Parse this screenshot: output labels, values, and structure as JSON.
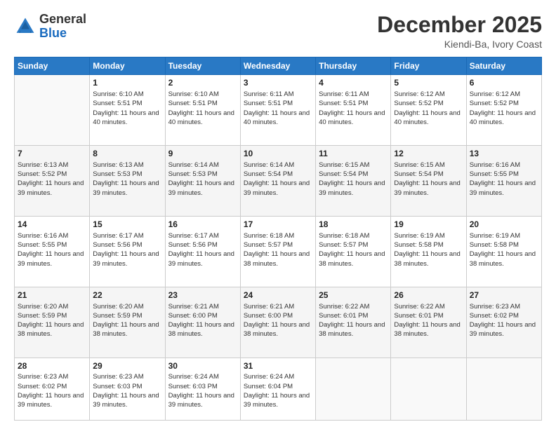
{
  "header": {
    "logo_general": "General",
    "logo_blue": "Blue",
    "month_title": "December 2025",
    "location": "Kiendi-Ba, Ivory Coast"
  },
  "days_of_week": [
    "Sunday",
    "Monday",
    "Tuesday",
    "Wednesday",
    "Thursday",
    "Friday",
    "Saturday"
  ],
  "weeks": [
    [
      {
        "day": "",
        "sunrise": "",
        "sunset": "",
        "daylight": "",
        "empty": true
      },
      {
        "day": "1",
        "sunrise": "Sunrise: 6:10 AM",
        "sunset": "Sunset: 5:51 PM",
        "daylight": "Daylight: 11 hours and 40 minutes."
      },
      {
        "day": "2",
        "sunrise": "Sunrise: 6:10 AM",
        "sunset": "Sunset: 5:51 PM",
        "daylight": "Daylight: 11 hours and 40 minutes."
      },
      {
        "day": "3",
        "sunrise": "Sunrise: 6:11 AM",
        "sunset": "Sunset: 5:51 PM",
        "daylight": "Daylight: 11 hours and 40 minutes."
      },
      {
        "day": "4",
        "sunrise": "Sunrise: 6:11 AM",
        "sunset": "Sunset: 5:51 PM",
        "daylight": "Daylight: 11 hours and 40 minutes."
      },
      {
        "day": "5",
        "sunrise": "Sunrise: 6:12 AM",
        "sunset": "Sunset: 5:52 PM",
        "daylight": "Daylight: 11 hours and 40 minutes."
      },
      {
        "day": "6",
        "sunrise": "Sunrise: 6:12 AM",
        "sunset": "Sunset: 5:52 PM",
        "daylight": "Daylight: 11 hours and 40 minutes."
      }
    ],
    [
      {
        "day": "7",
        "sunrise": "Sunrise: 6:13 AM",
        "sunset": "Sunset: 5:52 PM",
        "daylight": "Daylight: 11 hours and 39 minutes."
      },
      {
        "day": "8",
        "sunrise": "Sunrise: 6:13 AM",
        "sunset": "Sunset: 5:53 PM",
        "daylight": "Daylight: 11 hours and 39 minutes."
      },
      {
        "day": "9",
        "sunrise": "Sunrise: 6:14 AM",
        "sunset": "Sunset: 5:53 PM",
        "daylight": "Daylight: 11 hours and 39 minutes."
      },
      {
        "day": "10",
        "sunrise": "Sunrise: 6:14 AM",
        "sunset": "Sunset: 5:54 PM",
        "daylight": "Daylight: 11 hours and 39 minutes."
      },
      {
        "day": "11",
        "sunrise": "Sunrise: 6:15 AM",
        "sunset": "Sunset: 5:54 PM",
        "daylight": "Daylight: 11 hours and 39 minutes."
      },
      {
        "day": "12",
        "sunrise": "Sunrise: 6:15 AM",
        "sunset": "Sunset: 5:54 PM",
        "daylight": "Daylight: 11 hours and 39 minutes."
      },
      {
        "day": "13",
        "sunrise": "Sunrise: 6:16 AM",
        "sunset": "Sunset: 5:55 PM",
        "daylight": "Daylight: 11 hours and 39 minutes."
      }
    ],
    [
      {
        "day": "14",
        "sunrise": "Sunrise: 6:16 AM",
        "sunset": "Sunset: 5:55 PM",
        "daylight": "Daylight: 11 hours and 39 minutes."
      },
      {
        "day": "15",
        "sunrise": "Sunrise: 6:17 AM",
        "sunset": "Sunset: 5:56 PM",
        "daylight": "Daylight: 11 hours and 39 minutes."
      },
      {
        "day": "16",
        "sunrise": "Sunrise: 6:17 AM",
        "sunset": "Sunset: 5:56 PM",
        "daylight": "Daylight: 11 hours and 39 minutes."
      },
      {
        "day": "17",
        "sunrise": "Sunrise: 6:18 AM",
        "sunset": "Sunset: 5:57 PM",
        "daylight": "Daylight: 11 hours and 38 minutes."
      },
      {
        "day": "18",
        "sunrise": "Sunrise: 6:18 AM",
        "sunset": "Sunset: 5:57 PM",
        "daylight": "Daylight: 11 hours and 38 minutes."
      },
      {
        "day": "19",
        "sunrise": "Sunrise: 6:19 AM",
        "sunset": "Sunset: 5:58 PM",
        "daylight": "Daylight: 11 hours and 38 minutes."
      },
      {
        "day": "20",
        "sunrise": "Sunrise: 6:19 AM",
        "sunset": "Sunset: 5:58 PM",
        "daylight": "Daylight: 11 hours and 38 minutes."
      }
    ],
    [
      {
        "day": "21",
        "sunrise": "Sunrise: 6:20 AM",
        "sunset": "Sunset: 5:59 PM",
        "daylight": "Daylight: 11 hours and 38 minutes."
      },
      {
        "day": "22",
        "sunrise": "Sunrise: 6:20 AM",
        "sunset": "Sunset: 5:59 PM",
        "daylight": "Daylight: 11 hours and 38 minutes."
      },
      {
        "day": "23",
        "sunrise": "Sunrise: 6:21 AM",
        "sunset": "Sunset: 6:00 PM",
        "daylight": "Daylight: 11 hours and 38 minutes."
      },
      {
        "day": "24",
        "sunrise": "Sunrise: 6:21 AM",
        "sunset": "Sunset: 6:00 PM",
        "daylight": "Daylight: 11 hours and 38 minutes."
      },
      {
        "day": "25",
        "sunrise": "Sunrise: 6:22 AM",
        "sunset": "Sunset: 6:01 PM",
        "daylight": "Daylight: 11 hours and 38 minutes."
      },
      {
        "day": "26",
        "sunrise": "Sunrise: 6:22 AM",
        "sunset": "Sunset: 6:01 PM",
        "daylight": "Daylight: 11 hours and 38 minutes."
      },
      {
        "day": "27",
        "sunrise": "Sunrise: 6:23 AM",
        "sunset": "Sunset: 6:02 PM",
        "daylight": "Daylight: 11 hours and 39 minutes."
      }
    ],
    [
      {
        "day": "28",
        "sunrise": "Sunrise: 6:23 AM",
        "sunset": "Sunset: 6:02 PM",
        "daylight": "Daylight: 11 hours and 39 minutes."
      },
      {
        "day": "29",
        "sunrise": "Sunrise: 6:23 AM",
        "sunset": "Sunset: 6:03 PM",
        "daylight": "Daylight: 11 hours and 39 minutes."
      },
      {
        "day": "30",
        "sunrise": "Sunrise: 6:24 AM",
        "sunset": "Sunset: 6:03 PM",
        "daylight": "Daylight: 11 hours and 39 minutes."
      },
      {
        "day": "31",
        "sunrise": "Sunrise: 6:24 AM",
        "sunset": "Sunset: 6:04 PM",
        "daylight": "Daylight: 11 hours and 39 minutes."
      },
      {
        "day": "",
        "sunrise": "",
        "sunset": "",
        "daylight": "",
        "empty": true
      },
      {
        "day": "",
        "sunrise": "",
        "sunset": "",
        "daylight": "",
        "empty": true
      },
      {
        "day": "",
        "sunrise": "",
        "sunset": "",
        "daylight": "",
        "empty": true
      }
    ]
  ]
}
